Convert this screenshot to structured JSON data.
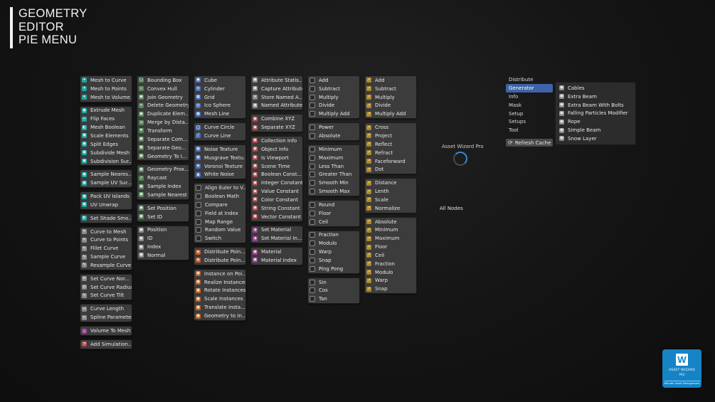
{
  "title": {
    "line1": "GEOMETRY",
    "line2": "EDITOR",
    "line3": "PIE MENU"
  },
  "columns": [
    {
      "id": "c1",
      "groups": [
        {
          "items": [
            [
              "Mesh to Curve",
              "teal",
              "✦"
            ],
            [
              "Mesh to Points",
              "teal",
              "✦"
            ],
            [
              "Mesh to Volume",
              "teal",
              "✦"
            ]
          ]
        },
        {
          "items": [
            [
              "Extrude Mesh",
              "teal",
              "▣"
            ],
            [
              "Flip Faces",
              "teal",
              "↔"
            ],
            [
              "Mesh Boolean",
              "teal",
              "◧"
            ],
            [
              "Scale Elements",
              "teal",
              "▣"
            ],
            [
              "Split Edges",
              "teal",
              "▣"
            ],
            [
              "Subdivide Mesh",
              "teal",
              "▣"
            ],
            [
              "Subdivision Sur...",
              "teal",
              "▣"
            ]
          ]
        },
        {
          "items": [
            [
              "Sample Neares...",
              "teal",
              "▣"
            ],
            [
              "Sample UV Sur...",
              "teal",
              "▣"
            ]
          ]
        },
        {
          "items": [
            [
              "Pack UV Islands",
              "teal",
              "▣"
            ],
            [
              "UV Unwrap",
              "teal",
              "▣"
            ]
          ]
        },
        {
          "items": [
            [
              "Set Shade Smo...",
              "teal",
              "◐"
            ]
          ]
        },
        {
          "items": [
            [
              "Curve to Mesh",
              "gray",
              "✎"
            ],
            [
              "Curve to Points",
              "gray",
              "✎"
            ],
            [
              "Fillet Curve",
              "gray",
              "✎"
            ],
            [
              "Sample Curve",
              "gray",
              "✎"
            ],
            [
              "Resample Curve",
              "gray",
              "✎"
            ]
          ]
        },
        {
          "items": [
            [
              "Set Curve Nor...",
              "gray",
              "≡"
            ],
            [
              "Set Curve Radius",
              "gray",
              "◎"
            ],
            [
              "Set Curve Tilt",
              "gray",
              "✎"
            ]
          ]
        },
        {
          "items": [
            [
              "Curve Length",
              "gray",
              "↦"
            ],
            [
              "Spline Parameter",
              "gray",
              "↦"
            ]
          ]
        },
        {
          "items": [
            [
              "Volume To Mesh",
              "magenta",
              "△"
            ]
          ]
        },
        {
          "items": [
            [
              "Add Simulation...",
              "red",
              "◔"
            ]
          ]
        }
      ]
    },
    {
      "id": "c2",
      "groups": [
        {
          "items": [
            [
              "Bounding Box",
              "green",
              "▢"
            ],
            [
              "Convex Hull",
              "green",
              "◇"
            ],
            [
              "Join Geometry",
              "green",
              "▣"
            ],
            [
              "Delete Geometry",
              "green",
              "✕"
            ],
            [
              "Duplicate Elem...",
              "green",
              "▣"
            ],
            [
              "Merge by Dista...",
              "green",
              "⇲"
            ],
            [
              "Transform",
              "green",
              "✥"
            ],
            [
              "Separate Com...",
              "green",
              "▣"
            ],
            [
              "Separate Geo...",
              "green",
              "▣"
            ],
            [
              "Geometry To I...",
              "green",
              "▣"
            ]
          ]
        },
        {
          "items": [
            [
              "Geometry Prox...",
              "green",
              "▣"
            ],
            [
              "Raycast",
              "green",
              "➚"
            ],
            [
              "Sample Index",
              "green",
              "▣"
            ],
            [
              "Sample Nearest",
              "green",
              "▣"
            ]
          ]
        },
        {
          "items": [
            [
              "Set Position",
              "green",
              "▣"
            ],
            [
              "Set ID",
              "green",
              "▣"
            ]
          ]
        },
        {
          "items": [
            [
              "Position",
              "gray",
              "▣"
            ],
            [
              "ID",
              "gray",
              "▣"
            ],
            [
              "Index",
              "gray",
              "▣"
            ],
            [
              "Normal",
              "gray",
              "▣"
            ]
          ]
        }
      ]
    },
    {
      "id": "c3",
      "groups": [
        {
          "items": [
            [
              "Cube",
              "blue",
              "▣"
            ],
            [
              "Cylinder",
              "blue",
              "◎"
            ],
            [
              "Grid",
              "blue",
              "▦"
            ],
            [
              "Ico Sphere",
              "blue",
              "◎"
            ],
            [
              "Mesh Line",
              "blue",
              "▣"
            ]
          ]
        },
        {
          "items": [
            [
              "Curve Circle",
              "blue",
              "◯"
            ],
            [
              "Curve Line",
              "blue",
              "╱"
            ]
          ]
        },
        {
          "items": [
            [
              "Noise Texture",
              "blue",
              "▦"
            ],
            [
              "Musgrave Textu...",
              "blue",
              "▦"
            ],
            [
              "Voronoi Texture",
              "blue",
              "◈"
            ],
            [
              "White Noise",
              "blue",
              "▲"
            ]
          ]
        },
        {
          "items": [
            [
              "Align Euler to V...",
              "dark",
              ""
            ],
            [
              "Boolean Math",
              "dark",
              ""
            ],
            [
              "Compare",
              "dark",
              ""
            ],
            [
              "Field at Index",
              "dark",
              ""
            ],
            [
              "Map Range",
              "dark",
              ""
            ],
            [
              "Random Value",
              "dark",
              ""
            ],
            [
              "Switch",
              "dark",
              ""
            ]
          ]
        },
        {
          "items": [
            [
              "Distribute Poin...",
              "orange",
              "◈"
            ],
            [
              "Distribute Poin...",
              "orange",
              "◈"
            ]
          ]
        },
        {
          "items": [
            [
              "Instance on Poi...",
              "orange",
              "▣"
            ],
            [
              "Realize Instances",
              "orange",
              "▣"
            ],
            [
              "Rotate Instances",
              "orange",
              "▣"
            ],
            [
              "Scale Instances",
              "orange",
              "▣"
            ],
            [
              "Translate Insta...",
              "orange",
              "▣"
            ],
            [
              "Geometry to In...",
              "orange",
              "▣"
            ]
          ]
        }
      ]
    },
    {
      "id": "c4",
      "groups": [
        {
          "items": [
            [
              "Attribute Statis...",
              "gray",
              "▣"
            ],
            [
              "Capture Attribute",
              "gray",
              "▣"
            ],
            [
              "Store Named A...",
              "gray",
              "a"
            ],
            [
              "Named Attribute",
              "gray",
              "▣"
            ]
          ]
        },
        {
          "items": [
            [
              "Combine XYZ",
              "red",
              "▣"
            ],
            [
              "Separate XYZ",
              "red",
              "▣"
            ]
          ]
        },
        {
          "items": [
            [
              "Collection Info",
              "red",
              "▣"
            ],
            [
              "Object Info",
              "red",
              "▣"
            ],
            [
              "Is Viewport",
              "red",
              "▣"
            ],
            [
              "Scene Time",
              "red",
              "▣"
            ],
            [
              "Boolean Const...",
              "red",
              "▣"
            ],
            [
              "Integer Constant",
              "red",
              "▣"
            ],
            [
              "Value Constant",
              "red",
              "▣"
            ],
            [
              "Color Constant",
              "red",
              "▣"
            ],
            [
              "String Constant",
              "red",
              "▣"
            ],
            [
              "Vector Constant",
              "red",
              "▣"
            ]
          ]
        },
        {
          "items": [
            [
              "Set Material",
              "magenta",
              "◑"
            ],
            [
              "Set Material In...",
              "magenta",
              "◑"
            ]
          ]
        },
        {
          "items": [
            [
              "Material",
              "magenta",
              "▣"
            ],
            [
              "Material Index",
              "magenta",
              "▣"
            ]
          ]
        }
      ]
    },
    {
      "id": "c5",
      "groups": [
        {
          "items": [
            [
              "Add",
              "dark",
              ""
            ],
            [
              "Subtract",
              "dark",
              ""
            ],
            [
              "Multiply",
              "dark",
              ""
            ],
            [
              "Divide",
              "dark",
              ""
            ],
            [
              "Multiply Add",
              "dark",
              ""
            ]
          ]
        },
        {
          "items": [
            [
              "Power",
              "dark",
              ""
            ],
            [
              "Absolute",
              "dark",
              ""
            ]
          ]
        },
        {
          "items": [
            [
              "Minimum",
              "dark",
              ""
            ],
            [
              "Maximum",
              "dark",
              ""
            ],
            [
              "Less Than",
              "dark",
              ""
            ],
            [
              "Greater Than",
              "dark",
              ""
            ],
            [
              "Smooth Min",
              "dark",
              ""
            ],
            [
              "Smooth Max",
              "dark",
              ""
            ]
          ]
        },
        {
          "items": [
            [
              "Round",
              "dark",
              ""
            ],
            [
              "Floor",
              "dark",
              ""
            ],
            [
              "Ceil",
              "dark",
              ""
            ]
          ]
        },
        {
          "items": [
            [
              "Fraction",
              "dark",
              ""
            ],
            [
              "Modulo",
              "dark",
              ""
            ],
            [
              "Warp",
              "dark",
              ""
            ],
            [
              "Snap",
              "dark",
              ""
            ],
            [
              "Ping Pong",
              "dark",
              ""
            ]
          ]
        },
        {
          "items": [
            [
              "Sin",
              "dark",
              ""
            ],
            [
              "Cos",
              "dark",
              ""
            ],
            [
              "Tan",
              "dark",
              ""
            ]
          ]
        }
      ]
    },
    {
      "id": "c6",
      "groups": [
        {
          "items": [
            [
              "Add",
              "yellow",
              "↗"
            ],
            [
              "Subtract",
              "yellow",
              "↗"
            ],
            [
              "Multiply",
              "yellow",
              "↗"
            ],
            [
              "Divide",
              "yellow",
              "↗"
            ],
            [
              "Multiply Add",
              "yellow",
              "↗"
            ]
          ]
        },
        {
          "items": [
            [
              "Cross",
              "yellow",
              "↗"
            ],
            [
              "Project",
              "yellow",
              "↗"
            ],
            [
              "Reflect",
              "yellow",
              "↗"
            ],
            [
              "Refract",
              "yellow",
              "↗"
            ],
            [
              "Faceforward",
              "yellow",
              "↗"
            ],
            [
              "Dot",
              "yellow",
              "↗"
            ]
          ]
        },
        {
          "items": [
            [
              "Distance",
              "yellow",
              "↗"
            ],
            [
              "Lenth",
              "yellow",
              "↗"
            ],
            [
              "Scale",
              "yellow",
              "↗"
            ],
            [
              "Normalize",
              "yellow",
              "↗"
            ]
          ]
        },
        {
          "items": [
            [
              "Absolute",
              "yellow",
              "↗"
            ],
            [
              "Minimum",
              "yellow",
              "↗"
            ],
            [
              "Maximum",
              "yellow",
              "↗"
            ],
            [
              "Floor",
              "yellow",
              "↗"
            ],
            [
              "Ceil",
              "yellow",
              "↗"
            ],
            [
              "Fraction",
              "yellow",
              "↗"
            ],
            [
              "Modulo",
              "yellow",
              "↗"
            ],
            [
              "Warp",
              "yellow",
              "↗"
            ],
            [
              "Snap",
              "yellow",
              "↗"
            ]
          ]
        }
      ]
    }
  ],
  "categories": [
    "Distribute",
    "Generator",
    "Info",
    "Mask",
    "Setup",
    "Setups",
    "Tool"
  ],
  "active_category": "Generator",
  "generator_items": [
    "Cables",
    "Extra Beam",
    "Extra Beam With Bolts",
    "Falling Particles Modifier",
    "Rope",
    "Simple Beam",
    "Snow Layer"
  ],
  "refresh_label": "Refresh Cache",
  "asset_wizard_label": "Asset Wizard Pro",
  "all_nodes_label": "All Nodes",
  "logo": {
    "mark": "W",
    "line1": "ASSET WIZARD",
    "line2": "PRO",
    "line3": "Blender Asset Management"
  },
  "colors": {
    "teal": "#1fa7a2",
    "green": "#58885a",
    "blue": "#4b73c4",
    "red": "#b5454f",
    "orange": "#c0662a",
    "magenta": "#9c3f97",
    "yellow": "#b08a2a",
    "accent": "#3f63a8"
  }
}
